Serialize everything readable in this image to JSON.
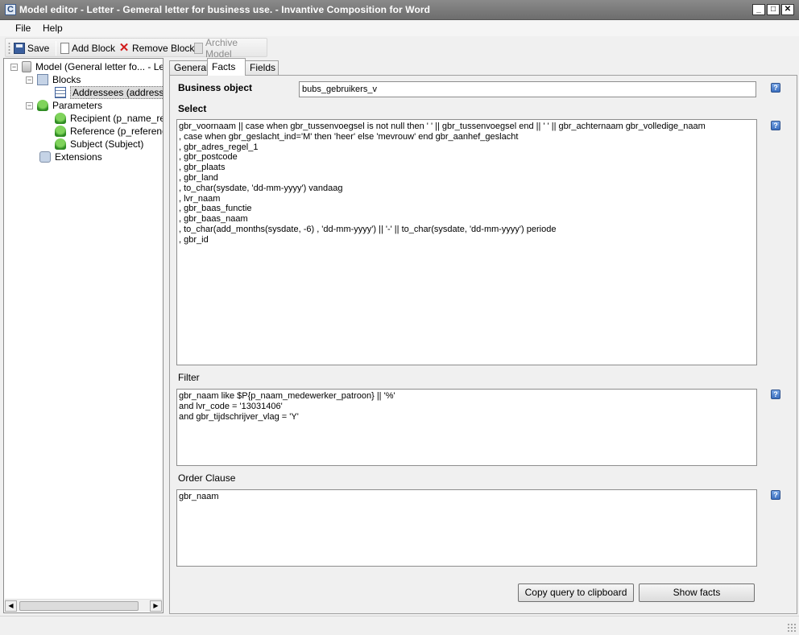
{
  "window": {
    "title": "Model editor - Letter - Gemeral letter for business use. - Invantive Composition for Word",
    "app_icon_letter": "C",
    "minimize": "_",
    "maximize": "□",
    "close": "✕"
  },
  "menu": {
    "items": [
      "File",
      "Help"
    ]
  },
  "toolbar": {
    "save": "Save",
    "add_block": "Add Block",
    "remove_block": "Remove Block",
    "archive_model": "Archive Model"
  },
  "tree": {
    "model": "Model (General letter fo... - Lette",
    "blocks": "Blocks",
    "addressees": "Addressees (addressee)",
    "parameters": "Parameters",
    "recipient": "Recipient (p_name_recip",
    "reference": "Reference (p_reference)",
    "subject": "Subject (Subject)",
    "extensions": "Extensions",
    "toggle_minus": "−"
  },
  "tabs": [
    "General",
    "Facts",
    "Fields"
  ],
  "facts": {
    "business_object_label": "Business object",
    "business_object_value": "bubs_gebruikers_v",
    "select_label": "Select",
    "select_value": "gbr_voornaam || case when gbr_tussenvoegsel is not null then ' ' || gbr_tussenvoegsel end || ' ' || gbr_achternaam gbr_volledige_naam\n, case when gbr_geslacht_ind='M' then 'heer' else 'mevrouw' end gbr_aanhef_geslacht\n, gbr_adres_regel_1\n, gbr_postcode\n, gbr_plaats\n, gbr_land\n, to_char(sysdate, 'dd-mm-yyyy') vandaag\n, lvr_naam\n, gbr_baas_functie\n, gbr_baas_naam\n, to_char(add_months(sysdate, -6) , 'dd-mm-yyyy') || '-' || to_char(sysdate, 'dd-mm-yyyy') periode\n, gbr_id",
    "filter_label": "Filter",
    "filter_value": "gbr_naam like $P{p_naam_medewerker_patroon} || '%'\nand lvr_code = '13031406'\nand gbr_tijdschrijver_vlag = 'Y'",
    "order_label": "Order Clause",
    "order_value": "gbr_naam",
    "copy_button": "Copy query to clipboard",
    "show_facts_button": "Show facts",
    "help_glyph": "?"
  }
}
